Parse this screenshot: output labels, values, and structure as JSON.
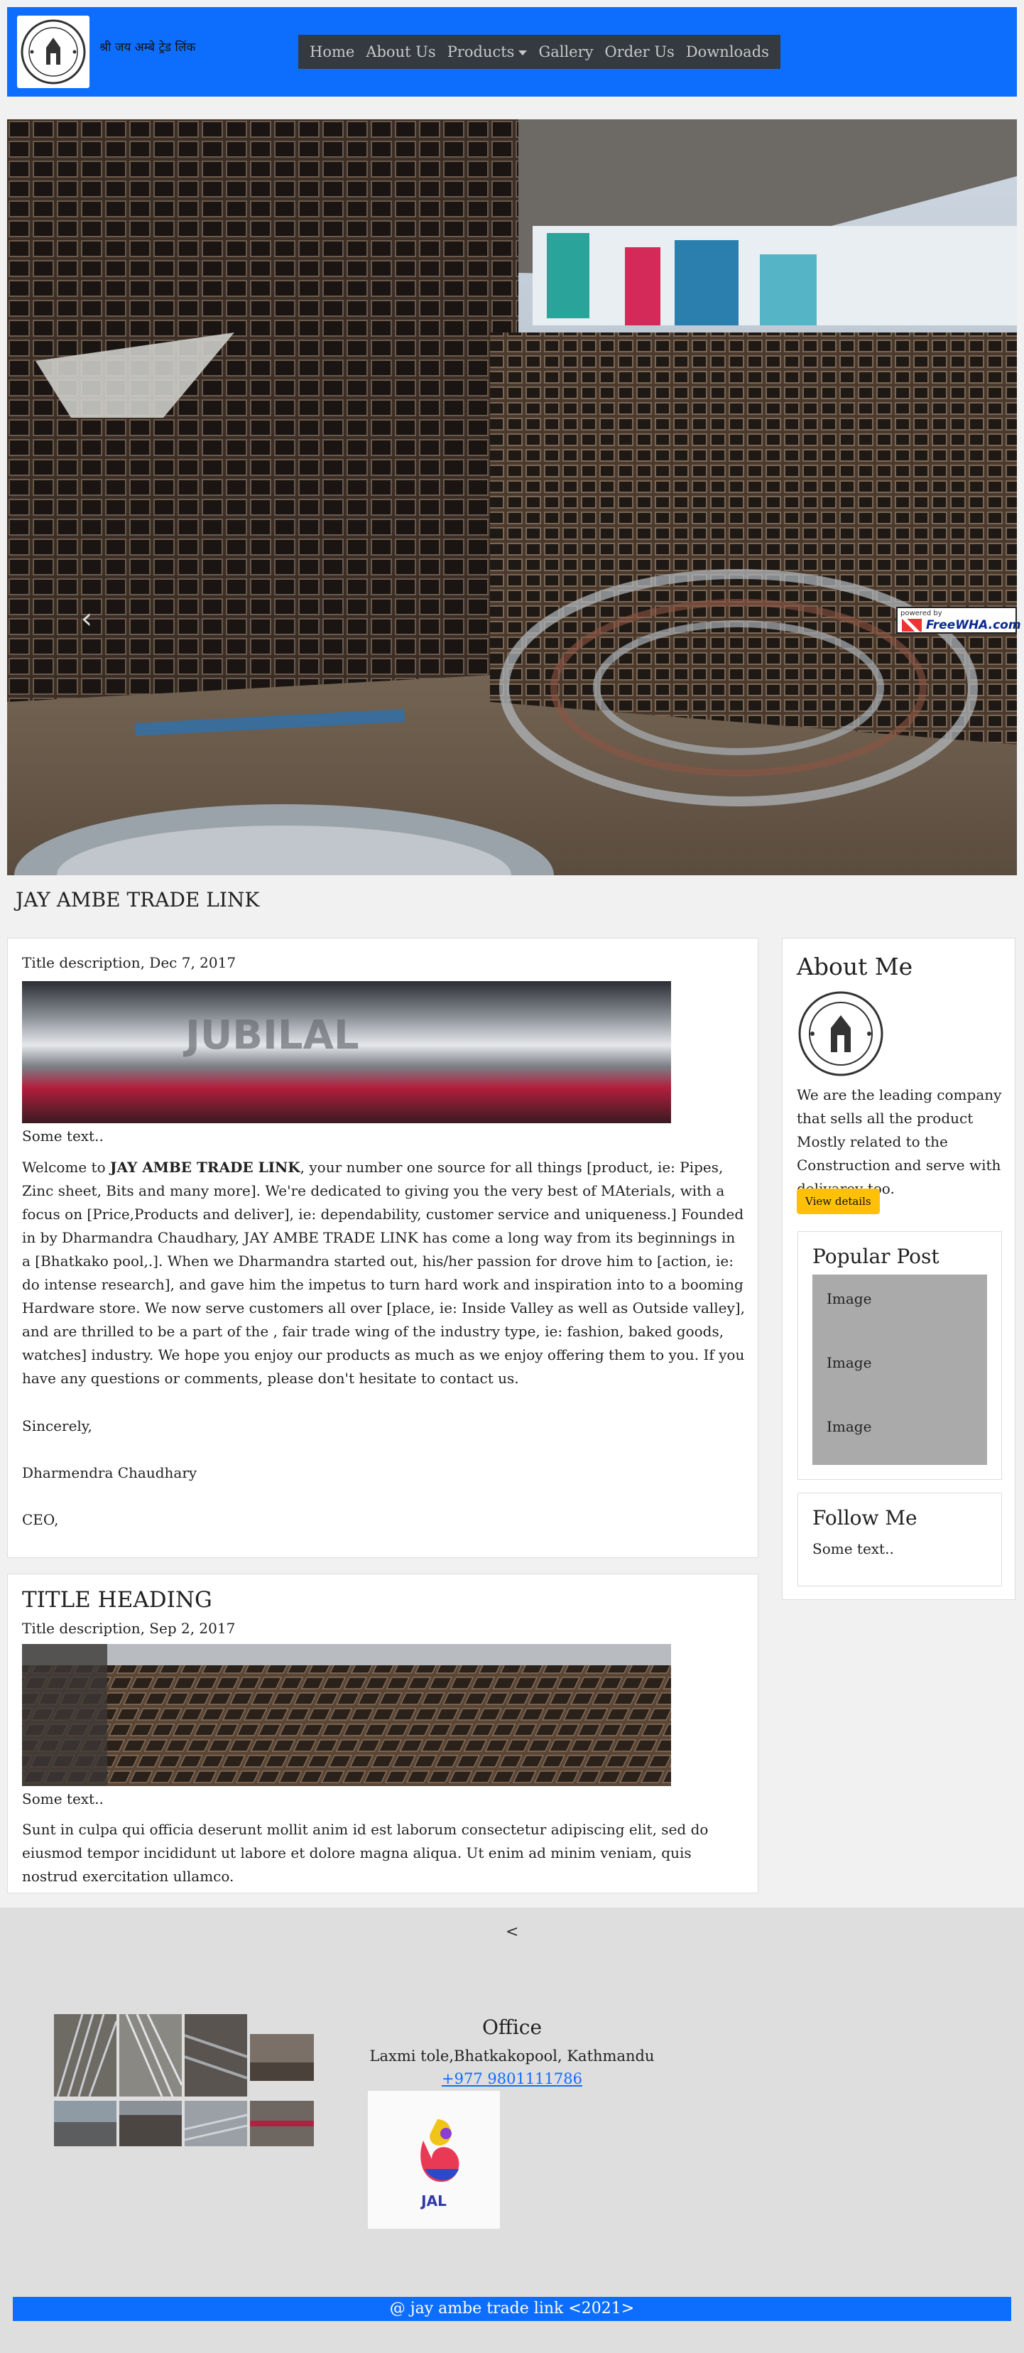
{
  "header": {
    "brand_text": "श्री जय अम्बे ट्रेड लिंक",
    "nav": [
      {
        "label": "Home"
      },
      {
        "label": "About Us"
      },
      {
        "label": "Products"
      },
      {
        "label": "Gallery"
      },
      {
        "label": "Order Us"
      },
      {
        "label": "Downloads"
      }
    ]
  },
  "hero": {
    "prev": "‹",
    "next": "›",
    "watermark_small": "powered by",
    "watermark_big": "FreeWHA.com"
  },
  "site_title": "JAY AMBE TRADE LINK",
  "post1": {
    "desc": "Title description, Dec 7, 2017",
    "some_text": "Some text..",
    "p_intro_before": "Welcome to ",
    "p_intro_bold": "JAY AMBE TRADE LINK",
    "p_intro_after": ", your number one source for all things [product, ie: Pipes, Zinc sheet, Bits and many more]. We're dedicated to giving you the very best of MAterials, with a focus on [Price,Products and deliver], ie: dependability, customer service and uniqueness.] Founded in by Dharmandra Chaudhary, JAY AMBE TRADE LINK has come a long way from its beginnings in a [Bhatkako pool,.]. When we Dharmandra started out, his/her passion for drove him to [action, ie: do intense research], and gave him the impetus to turn hard work and inspiration into to a booming Hardware store. We now serve customers all over [place, ie: Inside Valley as well as Outside valley], and are thrilled to be a part of the , fair trade wing of the industry type, ie: fashion, baked goods, watches] industry. We hope you enjoy our products as much as we enjoy offering them to you. If you have any questions or comments, please don't hesitate to contact us.",
    "sincerely": "Sincerely,",
    "name": "Dharmendra Chaudhary",
    "role": "CEO,"
  },
  "post2": {
    "heading": "TITLE HEADING",
    "desc": "Title description, Sep 2, 2017",
    "some_text": "Some text..",
    "paragraph": "Sunt in culpa qui officia deserunt mollit anim id est laborum consectetur adipiscing elit, sed do eiusmod tempor incididunt ut labore et dolore magna aliqua. Ut enim ad minim veniam, quis nostrud exercitation ullamco."
  },
  "sidebar": {
    "about_heading": "About Me",
    "about_text": "We are the leading company that sells all the product Mostly related to the Construction and serve with delivarey too.",
    "view_button": "View details",
    "popular_heading": "Popular Post",
    "popular_items": [
      "Image",
      "Image",
      "Image"
    ],
    "follow_heading": "Follow Me",
    "follow_text": "Some text.."
  },
  "footer": {
    "arrow": "<",
    "office_heading": "Office",
    "address": "Laxmi tole,Bhatkakopool, Kathmandu",
    "phone": "+977 9801111786",
    "logo_text": "JAL",
    "copyright": "@ jay ambe trade link <2021>"
  },
  "colors": {
    "primary": "#0d6efd",
    "nav_bg": "#343a40",
    "button_yellow": "#ffc107",
    "footer_bg": "#dedede"
  }
}
